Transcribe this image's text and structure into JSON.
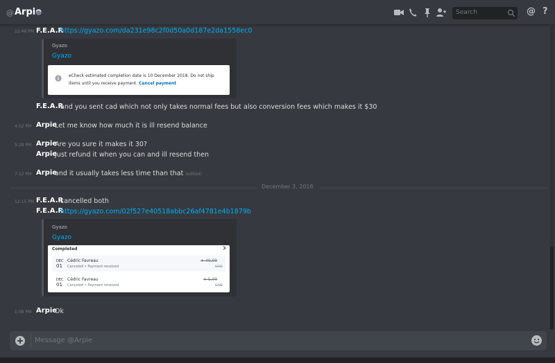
{
  "header": {
    "at_symbol": "@",
    "channel_name": "Arpie",
    "search_placeholder": "Search",
    "icons": [
      "video-call-icon",
      "voice-call-icon",
      "pin-icon",
      "add-friend-icon",
      "search-icon",
      "mentions-icon",
      "help-icon"
    ],
    "mentions_label": "@",
    "help_label": "?"
  },
  "messages": [
    {
      "time": "12:46 PM",
      "author": "F.E.A.R",
      "link": "https://gyazo.com/da231e98c2f0d50a0d187e2da1558ec0"
    },
    {
      "embed": {
        "provider": "Gyazo",
        "title": "Gyazo",
        "notice_text": "eCheck estimated completion date is 10 December 2018. Do not ship items until you receive payment.",
        "notice_link": "Cancel payment"
      }
    },
    {
      "author": "F.E.A.R",
      "text": "and you sent cad which not only takes normal fees but also conversion fees which makes it $30"
    },
    {
      "time": "4:52 PM",
      "author": "Arpie",
      "text": "Let me know how much it is ill resend balance"
    },
    {
      "time": "5:28 PM",
      "author": "Arpie",
      "text": "Are you sure it makes it 30?"
    },
    {
      "author": "Arpie",
      "text": "Just refund it when you can and ill resend then"
    },
    {
      "time": "7:12 PM",
      "author": "Arpie",
      "text": "and it usually takes less time than that",
      "edited": "(edited)"
    },
    {
      "time": "12:15 PM",
      "author": "F.E.A.R",
      "text": "cancelled both"
    },
    {
      "author": "F.E.A.R",
      "link": "https://gyazo.com/02f527e40518abbc26af4781e4b1879b"
    },
    {
      "time": "1:08 PM",
      "author": "Arpie",
      "text": "Ok"
    }
  ],
  "date_divider": "December 3, 2018",
  "embed2": {
    "provider": "Gyazo",
    "title": "Gyazo",
    "panel_title": "Completed",
    "transactions": [
      {
        "month": "DEC",
        "day": "01",
        "name": "Cédric Favreau",
        "status": "Canceled • Payment received",
        "amount": "+ 40,00",
        "currency": "CAD"
      },
      {
        "month": "DEC",
        "day": "01",
        "name": "Cédric Favreau",
        "status": "Canceled • Payment received",
        "amount": "+ 5,00",
        "currency": "CAD"
      }
    ]
  },
  "composer": {
    "placeholder": "Message @Arpie"
  },
  "colors": {
    "background": "#36393f",
    "link": "#00b0f4",
    "author": "#ffffff",
    "muted": "#72767d",
    "paypal_blue": "#0070ba"
  }
}
